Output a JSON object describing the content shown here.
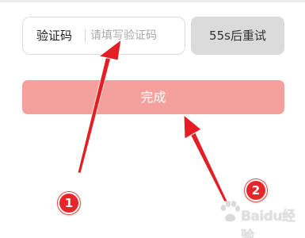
{
  "form": {
    "code_label": "验证码",
    "code_value": "",
    "code_placeholder": "请填写验证码",
    "resend_label": "55s后重试",
    "submit_label": "完成"
  },
  "annotations": {
    "markers": [
      {
        "label": "1"
      },
      {
        "label": "2"
      }
    ],
    "arrow_color": "#e31e24"
  },
  "watermark": {
    "text": "Baidu经验",
    "icon": "baidu-paw-icon"
  },
  "colors": {
    "submit_background": "#f4a19d",
    "resend_background": "#dcdbdc",
    "marker_background": "#e5262b"
  }
}
